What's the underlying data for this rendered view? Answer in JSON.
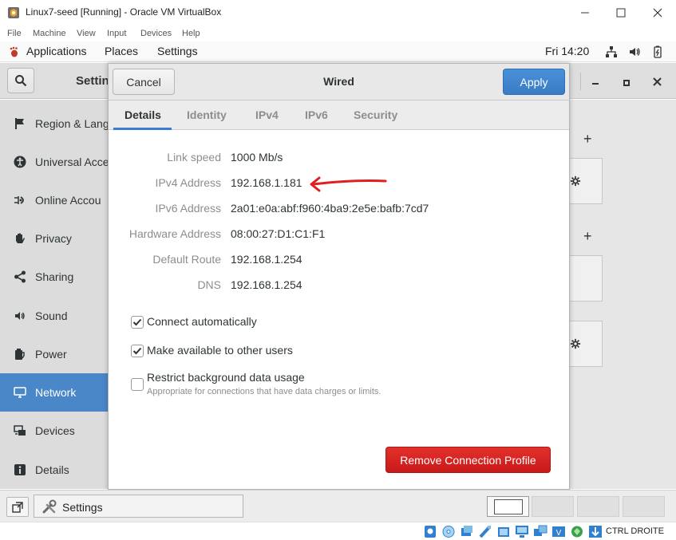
{
  "window": {
    "title": "Linux7-seed [Running] - Oracle VM VirtualBox",
    "menu": [
      "File",
      "Machine",
      "View",
      "Input",
      "Devices",
      "Help"
    ]
  },
  "gnome_bar": {
    "applications": "Applications",
    "places": "Places",
    "settings": "Settings",
    "clock": "Fri 14:20"
  },
  "settings": {
    "title_peek": "Settin",
    "sidebar": [
      {
        "label": "Region & Lang",
        "icon": "flag-icon"
      },
      {
        "label": "Universal Acce",
        "icon": "accessibility-icon"
      },
      {
        "label": "Online Accou",
        "icon": "online-accounts-icon"
      },
      {
        "label": "Privacy",
        "icon": "hand-icon"
      },
      {
        "label": "Sharing",
        "icon": "share-icon"
      },
      {
        "label": "Sound",
        "icon": "speaker-icon"
      },
      {
        "label": "Power",
        "icon": "power-icon"
      },
      {
        "label": "Network",
        "icon": "network-icon",
        "active": true
      },
      {
        "label": "Devices",
        "icon": "devices-icon"
      },
      {
        "label": "Details",
        "icon": "info-icon"
      }
    ]
  },
  "dialog": {
    "title": "Wired",
    "cancel_label": "Cancel",
    "apply_label": "Apply",
    "tabs": [
      "Details",
      "Identity",
      "IPv4",
      "IPv6",
      "Security"
    ],
    "active_tab": "Details",
    "details": [
      {
        "label": "Link speed",
        "value": "1000 Mb/s"
      },
      {
        "label": "IPv4 Address",
        "value": "192.168.1.181"
      },
      {
        "label": "IPv6 Address",
        "value": "2a01:e0a:abf:f960:4ba9:2e5e:bafb:7cd7"
      },
      {
        "label": "Hardware Address",
        "value": "08:00:27:D1:C1:F1"
      },
      {
        "label": "Default Route",
        "value": "192.168.1.254"
      },
      {
        "label": "DNS",
        "value": "192.168.1.254"
      }
    ],
    "options": [
      {
        "label": "Connect automatically",
        "checked": true
      },
      {
        "label": "Make available to other users",
        "checked": true
      },
      {
        "label": "Restrict background data usage",
        "checked": false,
        "sublabel": "Appropriate for connections that have data charges or limits."
      }
    ],
    "remove_label": "Remove Connection Profile"
  },
  "taskbar": {
    "task_label": "Settings"
  },
  "statusbar": {
    "host_key": "CTRL DROITE"
  },
  "colors": {
    "accent": "#4a87c9",
    "apply": "#3a7cc4",
    "destructive": "#d62623",
    "annotation": "#e02020"
  }
}
